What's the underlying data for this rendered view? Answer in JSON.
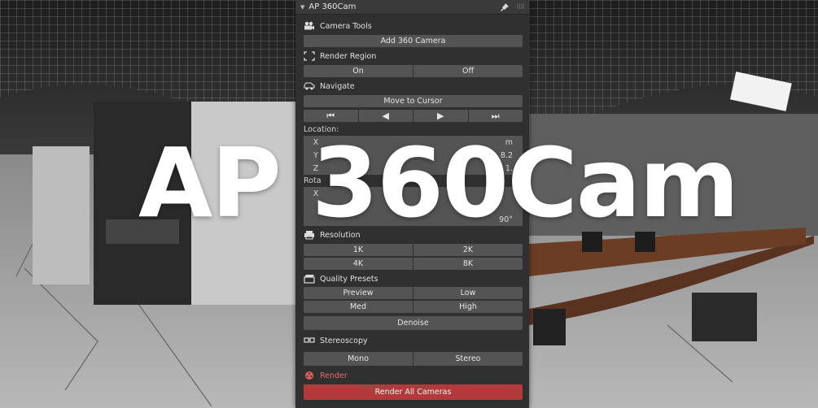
{
  "overlay_title": "AP 360Cam",
  "panel": {
    "title": "AP 360Cam",
    "camera_tools": {
      "label": "Camera Tools",
      "add_button": "Add 360 Camera"
    },
    "render_region": {
      "label": "Render Region",
      "on": "On",
      "off": "Off"
    },
    "navigate": {
      "label": "Navigate",
      "move_button": "Move to Cursor",
      "first": "⏮",
      "prev": "◀",
      "next": "▶",
      "last": "⏭"
    },
    "location": {
      "label": "Location:",
      "x_axis": "X",
      "x_value": "m",
      "y_axis": "Y",
      "y_value": "8.2",
      "z_axis": "Z",
      "z_value": "1."
    },
    "rotation": {
      "label": "Rota",
      "x_axis": "X",
      "y_value": "",
      "z_value": "90°"
    },
    "resolution": {
      "label": "Resolution",
      "options": [
        "1K",
        "2K",
        "4K",
        "8K"
      ]
    },
    "quality": {
      "label": "Quality Presets",
      "options": [
        "Preview",
        "Low",
        "Med",
        "High"
      ],
      "denoise": "Denoise"
    },
    "stereoscopy": {
      "label": "Stereoscopy",
      "mono": "Mono",
      "stereo": "Stereo"
    },
    "render": {
      "label": "Render",
      "button": "Render All Cameras"
    }
  },
  "colors": {
    "panel_bg": "#303030",
    "button_bg": "#545454",
    "render_red": "#b23a3a",
    "render_icon": "#e05a5a"
  }
}
